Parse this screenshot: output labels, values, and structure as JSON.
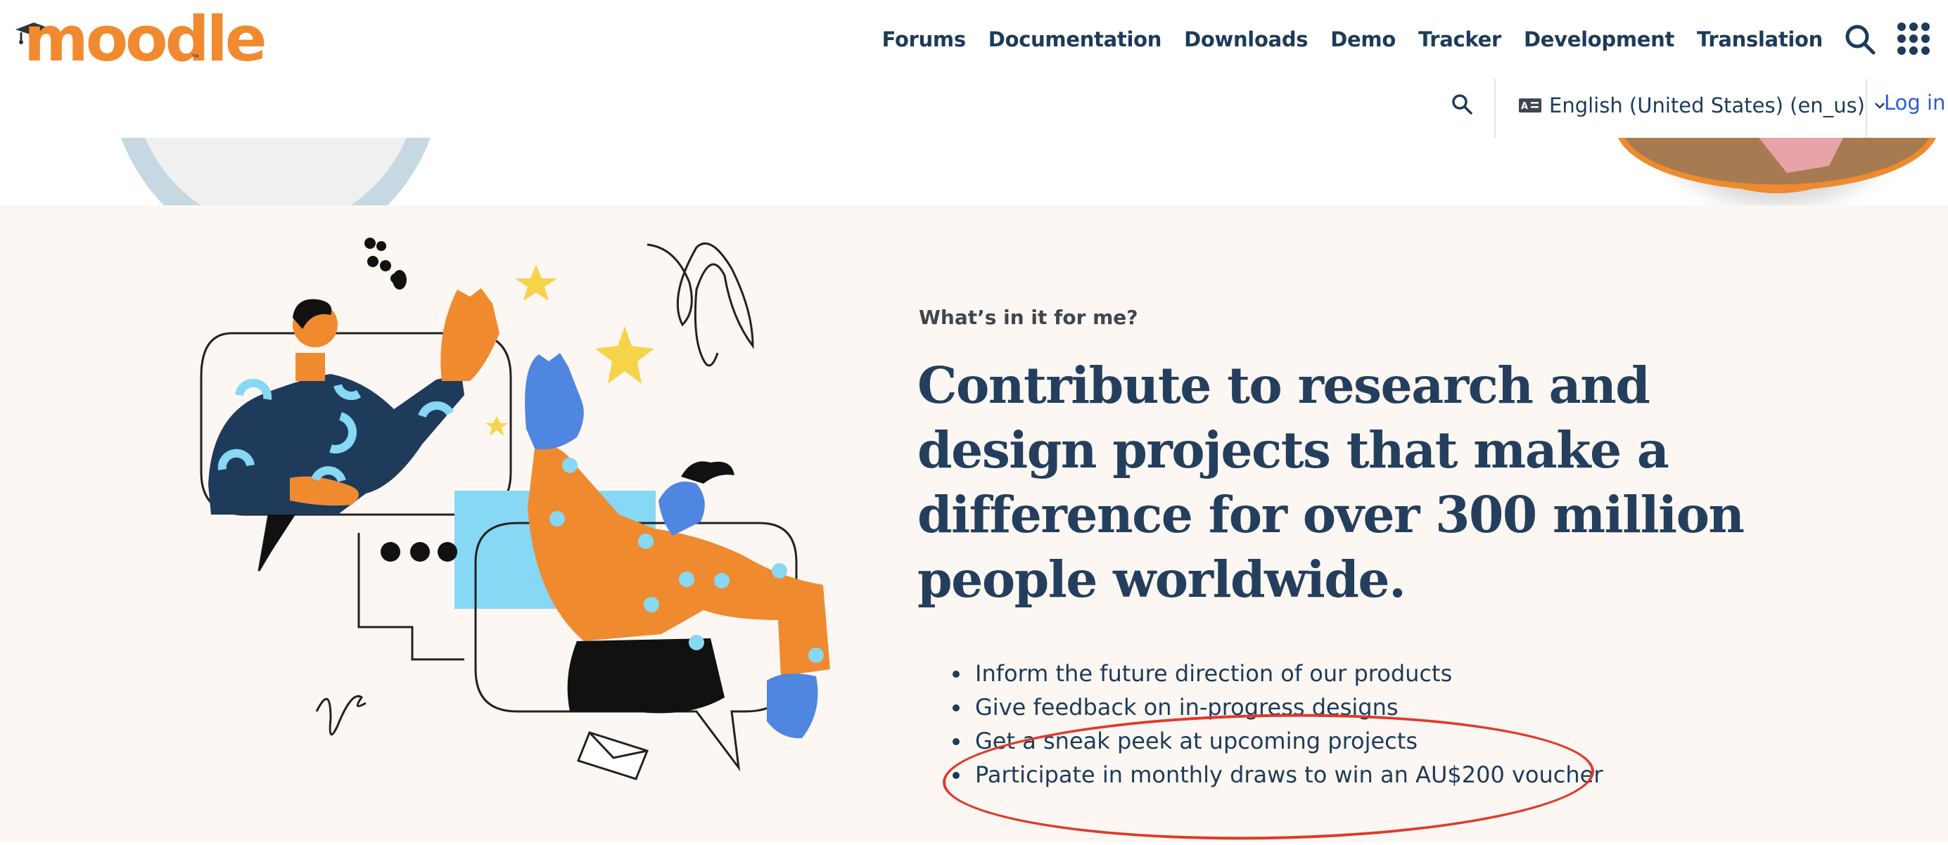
{
  "brand": {
    "logo_text": "moodle",
    "trademark": "™"
  },
  "main_nav": {
    "items": [
      "Forums",
      "Documentation",
      "Downloads",
      "Demo",
      "Tracker",
      "Development",
      "Translation"
    ]
  },
  "sub_nav": {
    "language_label": "English (United States) (en_us)",
    "login_label": "Log in"
  },
  "hero": {
    "kicker": "What’s in it for me?",
    "headline": "Contribute to research and design projects that make a difference for over 300 million people worldwide.",
    "bullets": [
      "Inform the future direction of our products",
      "Give feedback on in-progress designs",
      "Get a sneak peek at upcoming projects",
      "Participate in monthly draws to win an AU$200 voucher"
    ]
  },
  "colors": {
    "brand_orange": "#f18a2f",
    "navy": "#1d3b5a",
    "link_blue": "#2a5dd1",
    "section_bg": "#fcf7f2",
    "annotation_red": "#e0392b"
  }
}
